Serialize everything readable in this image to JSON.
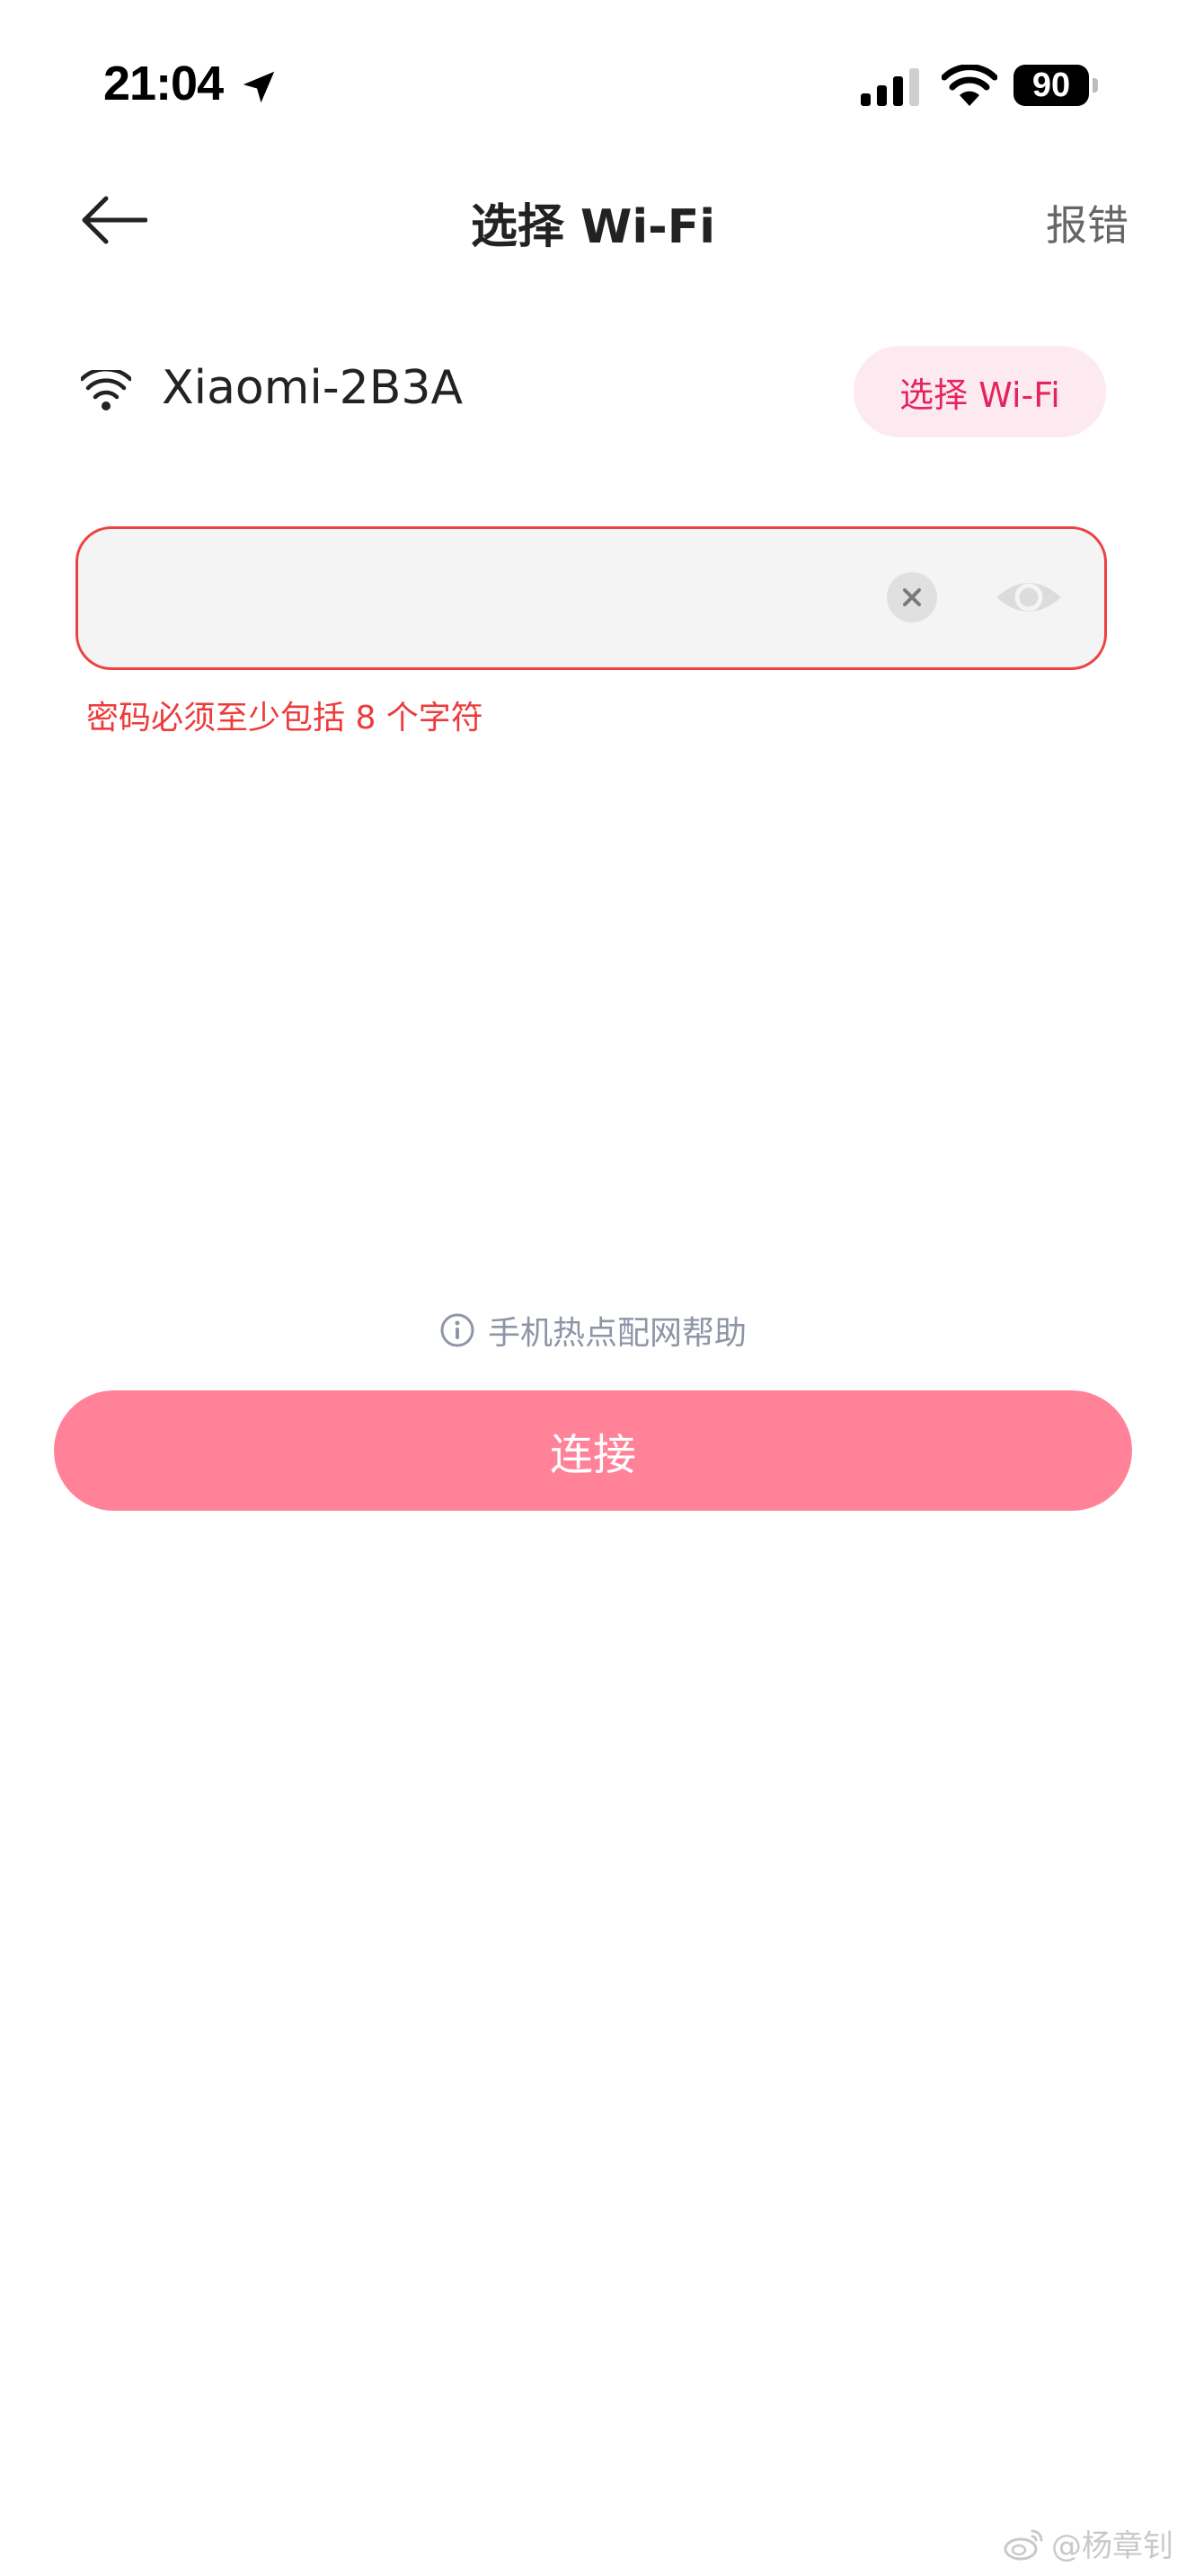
{
  "status_bar": {
    "time": "21:04",
    "battery_level": "90"
  },
  "header": {
    "title": "选择 Wi-Fi",
    "report_label": "报错"
  },
  "wifi": {
    "current_network": "Xiaomi-2B3A",
    "select_button_label": "选择 Wi-Fi"
  },
  "password": {
    "value": "",
    "error_message": "密码必须至少包括 8 个字符"
  },
  "help": {
    "label": "手机热点配网帮助"
  },
  "connect_button_label": "连接",
  "watermark": {
    "text": "@杨章钊"
  },
  "colors": {
    "accent": "#ff8299",
    "accent_text": "#e5245f",
    "error": "#ee3a3a"
  }
}
